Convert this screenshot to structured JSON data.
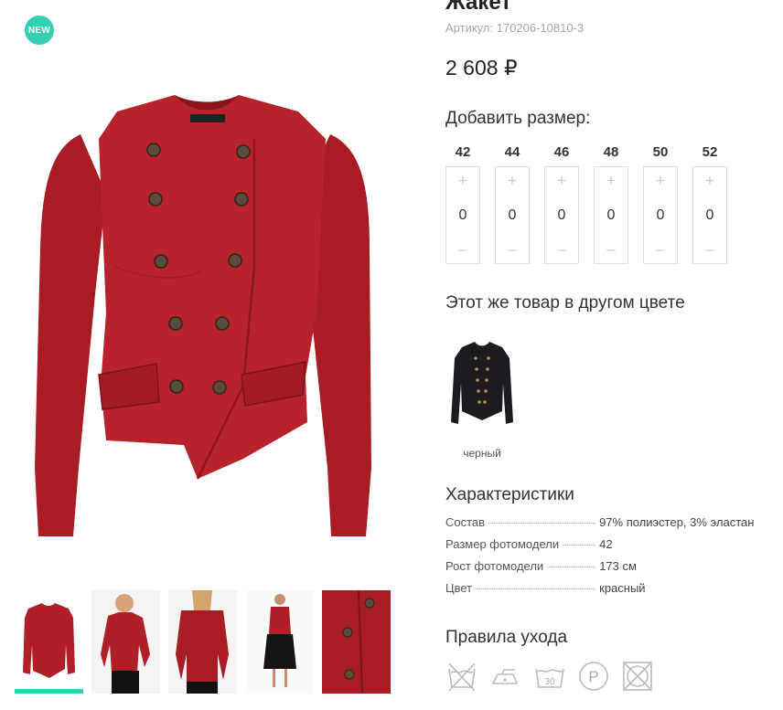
{
  "badge": {
    "label": "NEW"
  },
  "product": {
    "title": "Жакет",
    "sku": "Артикул: 170206-10810-3",
    "price": "2 608 ₽"
  },
  "sizes": {
    "title": "Добавить размер:",
    "items": [
      {
        "size": "42",
        "qty": "0"
      },
      {
        "size": "44",
        "qty": "0"
      },
      {
        "size": "46",
        "qty": "0"
      },
      {
        "size": "48",
        "qty": "0"
      },
      {
        "size": "50",
        "qty": "0"
      },
      {
        "size": "52",
        "qty": "0"
      }
    ],
    "plus": "+",
    "minus": "–"
  },
  "other_colors": {
    "title": "Этот же товар в другом цвете",
    "items": [
      {
        "name": "черный"
      }
    ]
  },
  "specs": {
    "title": "Характеристики",
    "rows": [
      {
        "key": "Состав",
        "value": "97% полиэстер, 3% эластан"
      },
      {
        "key": "Размер фотомодели",
        "value": "42"
      },
      {
        "key": "Рост фотомодели",
        "value": "173 см"
      },
      {
        "key": "Цвет",
        "value": "красный"
      }
    ]
  },
  "care": {
    "title": "Правила ухода",
    "icons": [
      "no-wash-icon",
      "iron-low-icon",
      "wash-30-icon",
      "dry-clean-p-icon",
      "no-tumble-dry-icon"
    ],
    "wash_temp": "30",
    "dry_clean_letter": "P"
  },
  "colors": {
    "accent": "#35cfb3",
    "product_red": "#b01e26",
    "product_black": "#1c1c20"
  }
}
